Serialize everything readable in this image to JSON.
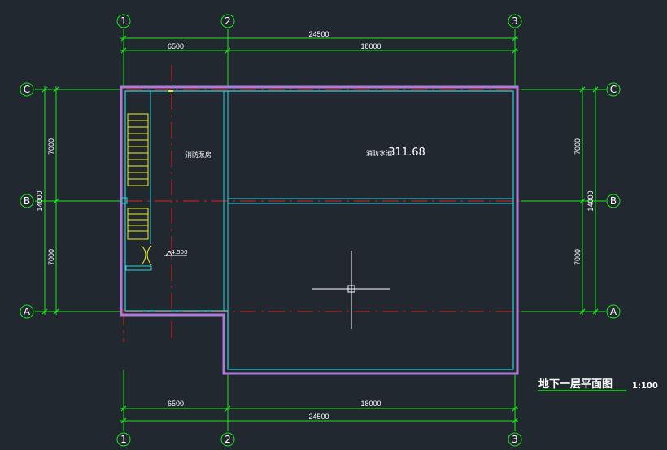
{
  "colors": {
    "background": "#212830",
    "dimension": "#19e619",
    "axis": "#e02020",
    "wall_outer": "#b07ad8",
    "wall_inner": "#28d4e0",
    "stair": "#f0f020",
    "crosshair": "#ffffff"
  },
  "axes": {
    "v1": "1",
    "v2": "2",
    "v3": "3",
    "hA": "A",
    "hB": "B",
    "hC": "C"
  },
  "dims": {
    "top_total": "24500",
    "top_left": "6500",
    "top_right": "18000",
    "bottom_total": "24500",
    "bottom_left": "6500",
    "bottom_right": "18000",
    "left_total": "14000",
    "left_upper": "7000",
    "left_lower": "7000",
    "right_total": "14000",
    "right_upper": "7000",
    "right_lower": "7000"
  },
  "rooms": {
    "pump_room": "消防泵房",
    "pool_label": "消防水池",
    "pool_value": "311.68"
  },
  "elevation": "-4.500",
  "drawing": {
    "title": "地下一层平面图",
    "scale": "1:100"
  }
}
